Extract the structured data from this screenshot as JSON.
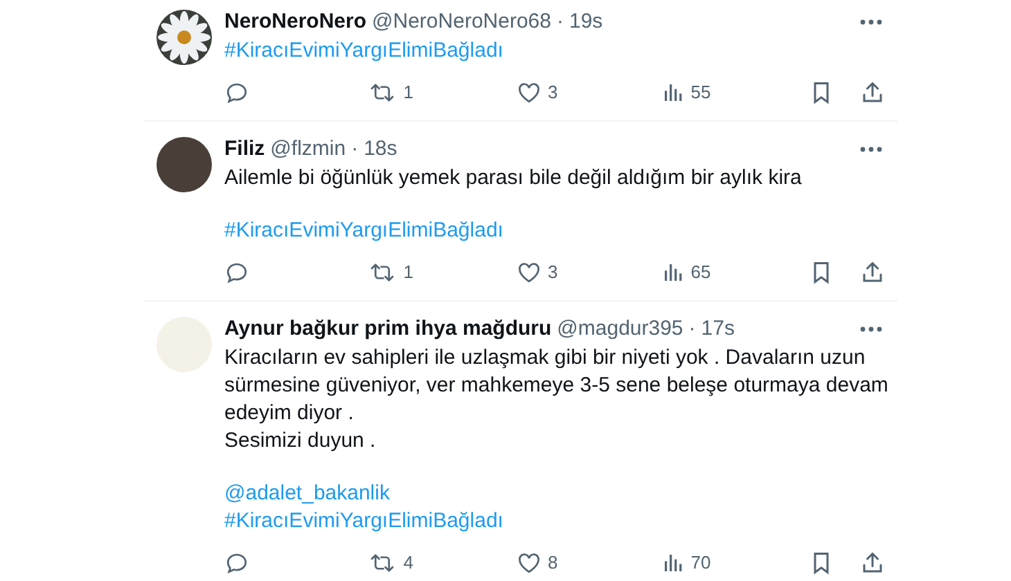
{
  "tweets": [
    {
      "name": "NeroNeroNero",
      "handle": "@NeroNeroNero68",
      "dot": "·",
      "time": "19s",
      "avatar": {
        "kind": "flower"
      },
      "links": [
        "#KiracıEvimiYargıElimiBağladı"
      ],
      "retweets": "1",
      "likes": "3",
      "views": "55"
    },
    {
      "name": "Filiz",
      "handle": "@flzmin",
      "dot": "·",
      "time": "18s",
      "avatar": {
        "kind": "photo"
      },
      "paragraphs": [
        "Ailemle bi öğünlük yemek parası bile değil aldığım bir aylık kira"
      ],
      "links": [
        "#KiracıEvimiYargıElimiBağladı"
      ],
      "retweets": "1",
      "likes": "3",
      "views": "65"
    },
    {
      "name": "Aynur bağkur prim ihya mağduru",
      "handle": "@magdur395",
      "dot": "·",
      "time": "17s",
      "avatar": {
        "kind": "image"
      },
      "paragraphs": [
        "Kiracıların ev sahipleri ile uzlaşmak gibi bir niyeti yok . Davaların uzun sürmesine güveniyor, ver mahkemeye 3-5 sene beleşe oturmaya devam edeyim diyor .",
        "Sesimizi duyun ."
      ],
      "links": [
        "@adalet_bakanlik",
        "#KiracıEvimiYargıElimiBağladı"
      ],
      "retweets": "4",
      "likes": "8",
      "views": "70"
    }
  ]
}
